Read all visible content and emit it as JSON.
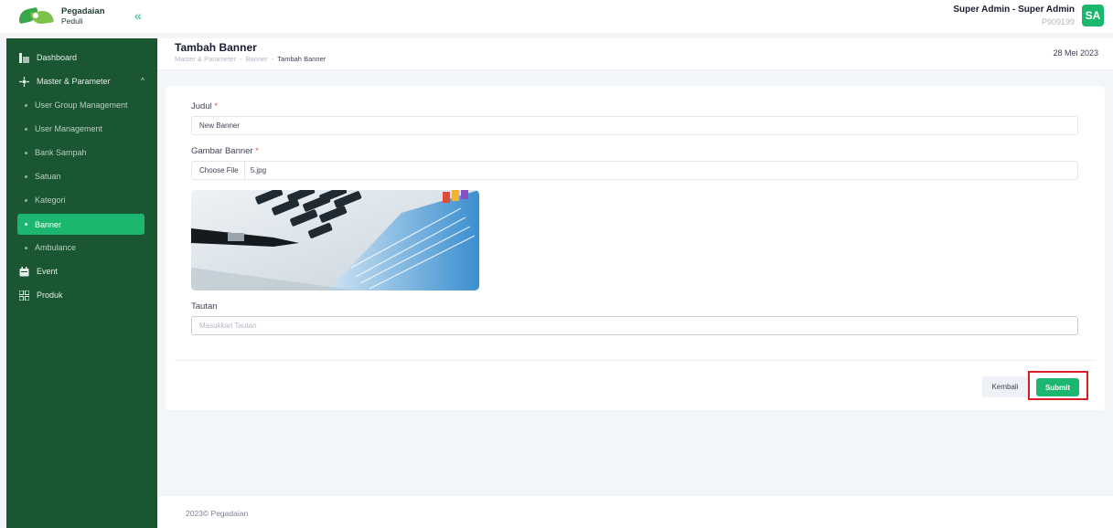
{
  "brand": {
    "line1": "Pegadaian",
    "line2": "Peduli"
  },
  "header": {
    "collapse_icon": "«",
    "user_name": "Super Admin - Super Admin",
    "user_id": "P909199",
    "avatar_initials": "SA"
  },
  "sidebar": {
    "dashboard": "Dashboard",
    "master": "Master & Parameter",
    "master_chevron": "^",
    "sub_items": [
      {
        "label": "User Group Management"
      },
      {
        "label": "User Management"
      },
      {
        "label": "Bank Sampah"
      },
      {
        "label": "Satuan"
      },
      {
        "label": "Kategori"
      },
      {
        "label": "Banner"
      },
      {
        "label": "Ambulance"
      }
    ],
    "event": "Event",
    "produk": "Produk"
  },
  "subheader": {
    "title": "Tambah Banner",
    "breadcrumb": [
      "Master & Parameter",
      "Banner",
      "Tambah Banner"
    ],
    "breadcrumb_sep": "-",
    "date": "28 Mei 2023"
  },
  "form": {
    "judul_label": "Judul",
    "required_mark": "*",
    "judul_value": "New Banner",
    "gambar_label": "Gambar Banner",
    "file_button": "Choose File",
    "file_name": "5.jpg",
    "tautan_label": "Tautan",
    "tautan_placeholder": "Masukkan Tautan",
    "back_label": "Kembali",
    "submit_label": "Submit"
  },
  "footer": {
    "text": "2023© Pegadaian"
  },
  "colors": {
    "primary": "#1bb76e",
    "sidebar": "#1a5632",
    "highlight": "#d91f26"
  }
}
